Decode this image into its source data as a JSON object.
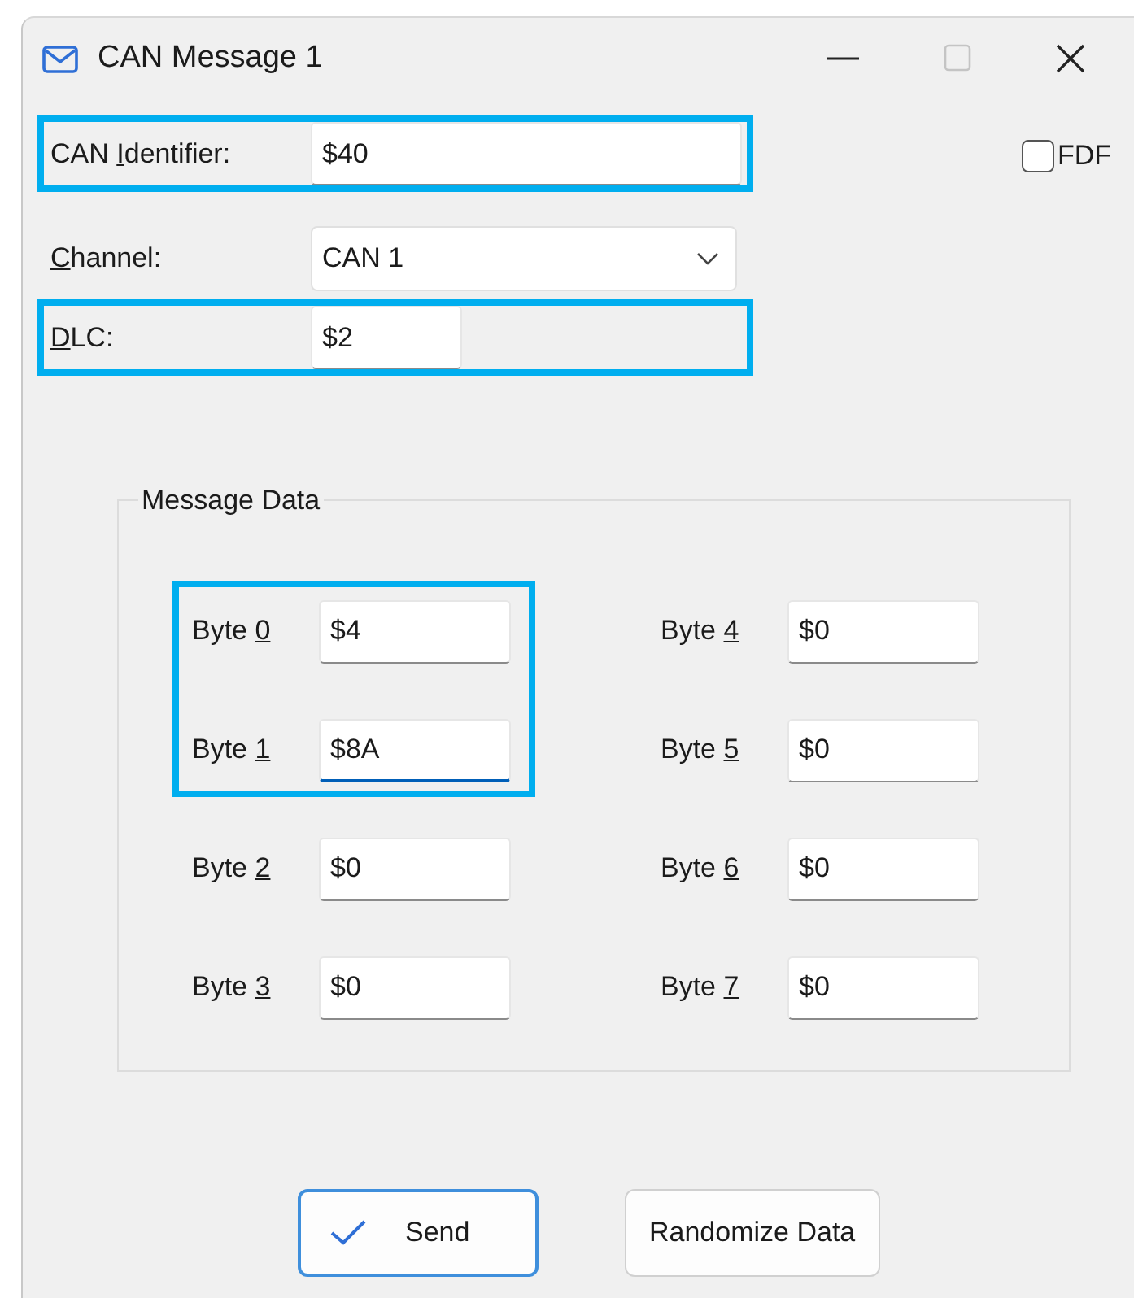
{
  "window": {
    "title": "CAN Message 1"
  },
  "fields": [
    {
      "kind": "text",
      "label_pre": "CAN ",
      "access_key": "I",
      "label_post": "dentifier:",
      "value": "$40",
      "highlighted": true
    },
    {
      "kind": "dropdown",
      "access_key": "C",
      "label_post": "hannel:",
      "value": "CAN 1",
      "highlighted": false
    },
    {
      "kind": "text",
      "access_key": "D",
      "label_post": "LC:",
      "value": "$2",
      "highlighted": true
    }
  ],
  "fdf": {
    "label": "FDF",
    "checked": false
  },
  "message_data": {
    "title": "Message Data",
    "bytes": [
      {
        "label_pre": "Byte ",
        "access_key": "0",
        "value": "$4",
        "highlighted": true,
        "focused": false
      },
      {
        "label_pre": "Byte ",
        "access_key": "1",
        "value": "$8A",
        "highlighted": true,
        "focused": true
      },
      {
        "label_pre": "Byte ",
        "access_key": "2",
        "value": "$0",
        "highlighted": false,
        "focused": false
      },
      {
        "label_pre": "Byte ",
        "access_key": "3",
        "value": "$0",
        "highlighted": false,
        "focused": false
      },
      {
        "label_pre": "Byte ",
        "access_key": "4",
        "value": "$0",
        "highlighted": false,
        "focused": false
      },
      {
        "label_pre": "Byte ",
        "access_key": "5",
        "value": "$0",
        "highlighted": false,
        "focused": false
      },
      {
        "label_pre": "Byte ",
        "access_key": "6",
        "value": "$0",
        "highlighted": false,
        "focused": false
      },
      {
        "label_pre": "Byte ",
        "access_key": "7",
        "value": "$0",
        "highlighted": false,
        "focused": false
      }
    ]
  },
  "buttons": [
    {
      "label": "Send",
      "kind": "default"
    },
    {
      "label": "Randomize Data",
      "kind": "normal"
    }
  ]
}
